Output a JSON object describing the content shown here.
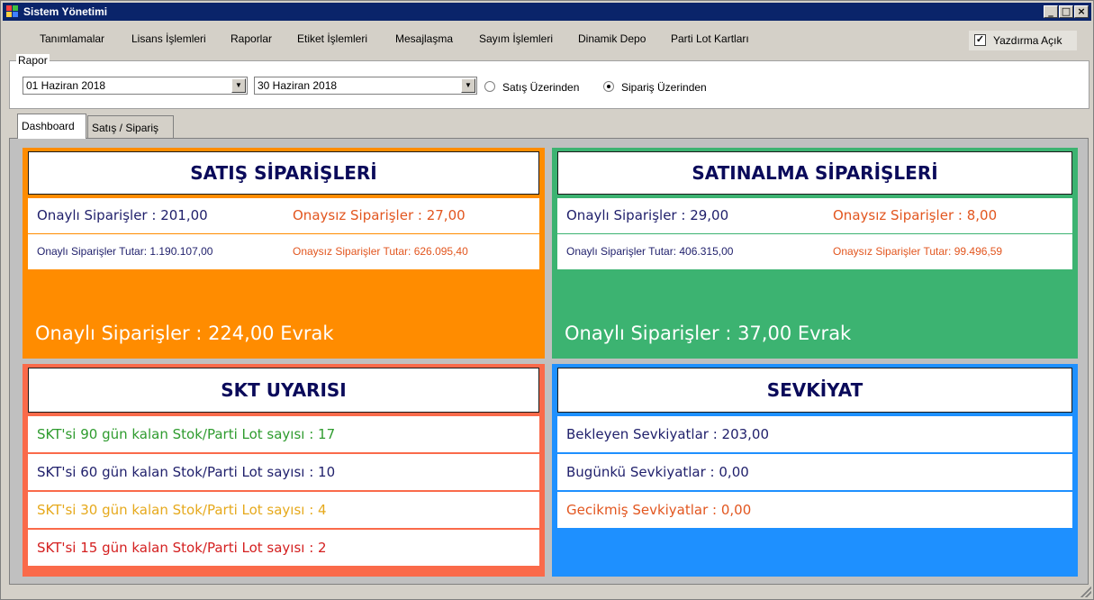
{
  "window": {
    "title": "Sistem Yönetimi"
  },
  "menu": {
    "items": [
      "Tanımlamalar",
      "Lisans İşlemleri",
      "Raporlar",
      "Etiket İşlemleri",
      "Mesajlaşma",
      "Sayım İşlemleri",
      "Dinamik Depo",
      "Parti Lot Kartları"
    ],
    "print_label": "Yazdırma Açık",
    "print_checked": true
  },
  "rapor": {
    "legend": "Rapor",
    "start_date": "01 Haziran 2018",
    "end_date": "30 Haziran 2018",
    "radio_sales": "Satış Üzerinden",
    "radio_orders": "Sipariş Üzerinden",
    "selected": "orders"
  },
  "tabs": [
    "Dashboard",
    "Satış / Sipariş"
  ],
  "sales_orders": {
    "title": "SATIŞ SİPARİŞLERİ",
    "approved": "Onaylı Siparişler : 201,00",
    "unapproved": "Onaysız Siparişler : 27,00",
    "approved_total": "Onaylı Siparişler Tutar: 1.190.107,00",
    "unapproved_total": "Onaysız Siparişler Tutar: 626.095,40",
    "summary": "Onaylı Siparişler : 224,00 Evrak"
  },
  "purchase_orders": {
    "title": "SATINALMA SİPARİŞLERİ",
    "approved": "Onaylı Siparişler : 29,00",
    "unapproved": "Onaysız Siparişler : 8,00",
    "approved_total": "Onaylı Siparişler Tutar: 406.315,00",
    "unapproved_total": "Onaysız Siparişler Tutar: 99.496,59",
    "summary": "Onaylı Siparişler : 37,00 Evrak"
  },
  "skt": {
    "title": "SKT UYARISI",
    "rows": [
      "SKT'si 90 gün kalan Stok/Parti Lot sayısı : 17",
      "SKT'si 60 gün kalan Stok/Parti Lot sayısı : 10",
      "SKT'si 30 gün kalan Stok/Parti Lot sayısı : 4",
      "SKT'si 15 gün kalan Stok/Parti Lot sayısı : 2"
    ]
  },
  "shipment": {
    "title": "SEVKİYAT",
    "rows": [
      "Bekleyen Sevkiyatlar : 203,00",
      "Bugünkü Sevkiyatlar : 0,00",
      "Gecikmiş Sevkiyatlar : 0,00"
    ]
  },
  "colors": {
    "sales_bg": "#ff8c00",
    "purchase_bg": "#3cb371",
    "skt_bg": "#fa6a4a",
    "shipment_bg": "#1e90ff",
    "navy_text": "#1f1f6b",
    "orange_text": "#e2561f",
    "green_text": "#2e9b2e",
    "yellow_text": "#e6a91c",
    "red_text": "#d42020"
  }
}
